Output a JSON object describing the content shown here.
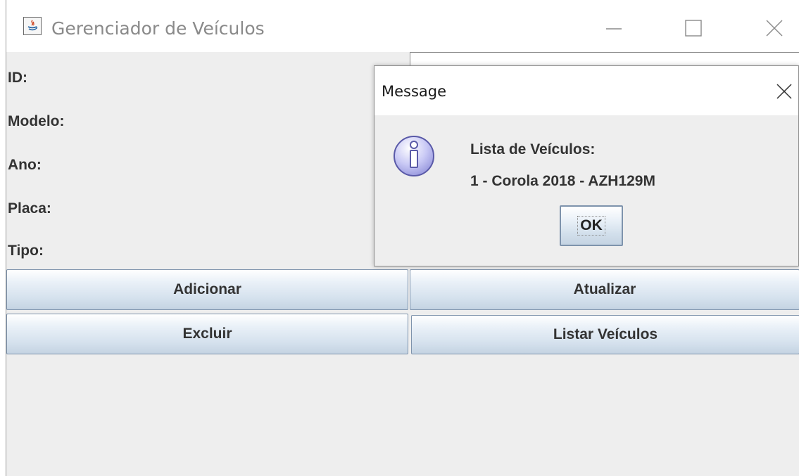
{
  "window": {
    "title": "Gerenciador de Veículos",
    "icon": "java-icon",
    "controls": [
      "minimize-icon",
      "maximize-icon",
      "close-icon"
    ]
  },
  "form": {
    "labels": [
      "ID:",
      "Modelo:",
      "Ano:",
      "Placa:",
      "Tipo:"
    ]
  },
  "buttons": {
    "add": "Adicionar",
    "update": "Atualizar",
    "delete": "Excluir",
    "list": "Listar Veículos"
  },
  "dialog": {
    "title": "Message",
    "icon": "info-icon",
    "lines": [
      "Lista de Veículos:",
      "1 - Corola 2018 - AZH129M"
    ],
    "ok_label": "OK"
  }
}
